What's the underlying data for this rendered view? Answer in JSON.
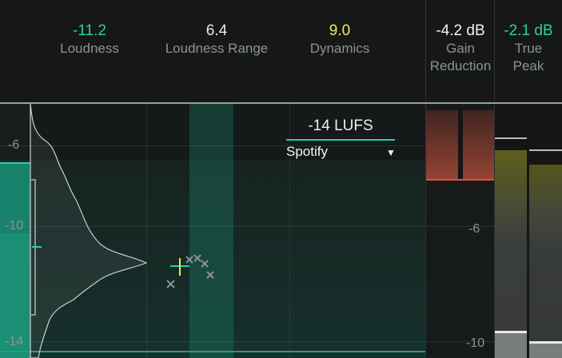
{
  "metrics": {
    "loudness": {
      "value": "-11.2",
      "label": "Loudness",
      "color": "#2ad1a6"
    },
    "loudness_range": {
      "value": "6.4",
      "label": "Loudness Range",
      "color": "#e8eaea"
    },
    "dynamics": {
      "value": "9.0",
      "label": "Dynamics",
      "color": "#f2ea5a"
    },
    "gain_reduction": {
      "value": "-4.2 dB",
      "label_line1": "Gain",
      "label_line2": "Reduction",
      "color": "#f0f2f2"
    },
    "true_peak": {
      "value": "-2.1 dB",
      "label_line1": "True",
      "label_line2": "Peak",
      "color": "#2ad1a6"
    }
  },
  "target": {
    "value": "-14 LUFS",
    "preset": "Spotify",
    "dropdown_icon": "caret-down-icon"
  },
  "main_axis": {
    "ticks": [
      "-6",
      "-10",
      "-14"
    ]
  },
  "gr_axis": {
    "ticks": [
      "-6",
      "-10"
    ]
  },
  "colors": {
    "accent": "#2ad1a6",
    "gain_red": "#e0553c",
    "peak_yellow": "#6b6a1e"
  }
}
